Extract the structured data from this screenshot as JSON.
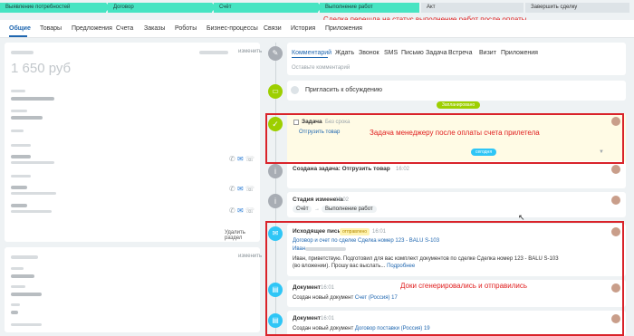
{
  "stages": [
    {
      "label": "Выявление потребностей",
      "state": "done"
    },
    {
      "label": "Договор",
      "state": "done"
    },
    {
      "label": "Счёт",
      "state": "done"
    },
    {
      "label": "Выполнение работ",
      "state": "done"
    },
    {
      "label": "Акт",
      "state": "todo"
    },
    {
      "label": "Завершить сделку",
      "state": "todo"
    }
  ],
  "stage_note": "Сделка перешла на статус выполнение работ после оплаты",
  "tabs": [
    "Общие",
    "Товары",
    "Предложения",
    "Счета",
    "Заказы",
    "Роботы",
    "Бизнес-процессы",
    "Связи",
    "История",
    "Приложения"
  ],
  "left": {
    "amount": "1 650 руб",
    "edit_label": "изменить",
    "remove_section": "Удалить раздел"
  },
  "timeline": {
    "tabs": [
      "Комментарий",
      "Ждать",
      "Звонок",
      "SMS",
      "Письмо",
      "Задача",
      "Встреча",
      "Визит",
      "Приложения"
    ],
    "comment_placeholder": "Оставьте комментарий",
    "invite": "Пригласить к обсуждению",
    "planned_badge": "Запланировано",
    "today_badge": "сегодня",
    "task": {
      "title": "Задача",
      "deadline": "Без срока",
      "action": "Отгрузить товар"
    },
    "task_note": "Задача менеджеру после оплаты счета прилетела",
    "created_task": {
      "title": "Создана задача: Отгрузить товар",
      "time": "16:02"
    },
    "stage_changed": {
      "title": "Стадия изменена",
      "time": "16:02",
      "from": "Счёт",
      "arrow": "→",
      "to": "Выполнение работ"
    },
    "email": {
      "title": "Исходящее письмо",
      "status": "отправлено",
      "time": "16:01",
      "subject": "Договор и счет по сделке Сделка номер 123 - BALU S-103",
      "to_name": "Иван",
      "body": "Иван, приветствую. Подготовил для вас комплект документов по сделке Сделка номер 123 - BALU S-103 (во вложении). Прошу вас выслать...",
      "more": "Подробнее"
    },
    "doc1": {
      "title": "Документ",
      "time": "16:01",
      "text": "Создан новый документ",
      "link": "Счет (Россия) 17"
    },
    "doc2": {
      "title": "Документ",
      "time": "16:01",
      "text": "Создан новый документ",
      "link": "Договор поставки (Россия) 19"
    },
    "docs_note": "Доки сгенерировались и отправились"
  },
  "colors": {
    "stage_done": "#47e4c2",
    "annotation_red": "#d9232a",
    "accent_blue": "#2067b0",
    "node_green": "#9dcf00",
    "node_blue": "#2fc6f6",
    "node_gray": "#a8adb4",
    "planned_green": "#9dcf00"
  }
}
